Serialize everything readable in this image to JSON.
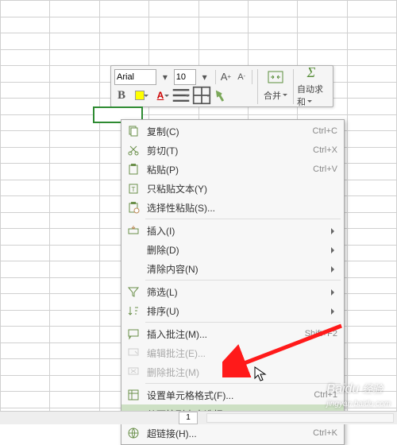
{
  "toolbar": {
    "font_name": "Arial",
    "font_size": "10",
    "merge_label": "合并",
    "autosum_label": "自动求和"
  },
  "context_menu": {
    "copy": {
      "label": "复制(C)",
      "shortcut": "Ctrl+C"
    },
    "cut": {
      "label": "剪切(T)",
      "shortcut": "Ctrl+X"
    },
    "paste": {
      "label": "粘贴(P)",
      "shortcut": "Ctrl+V"
    },
    "paste_text": {
      "label": "只粘贴文本(Y)"
    },
    "paste_special": {
      "label": "选择性粘贴(S)..."
    },
    "insert": {
      "label": "插入(I)"
    },
    "delete": {
      "label": "删除(D)"
    },
    "clear": {
      "label": "清除内容(N)"
    },
    "filter": {
      "label": "筛选(L)"
    },
    "sort": {
      "label": "排序(U)"
    },
    "insert_comment": {
      "label": "插入批注(M)...",
      "shortcut": "Shift+F2"
    },
    "edit_comment": {
      "label": "编辑批注(E)..."
    },
    "delete_comment": {
      "label": "删除批注(M)"
    },
    "format_cells": {
      "label": "设置单元格格式(F)...",
      "shortcut": "Ctrl+1"
    },
    "pick_list": {
      "label": "从下拉列表中选择(K)..."
    },
    "hyperlink": {
      "label": "超链接(H)...",
      "shortcut": "Ctrl+K"
    }
  },
  "watermark": {
    "brand": "Baidu",
    "sub": "经验",
    "url": "jingyan.baidu.com"
  },
  "sheet_tab": "1"
}
